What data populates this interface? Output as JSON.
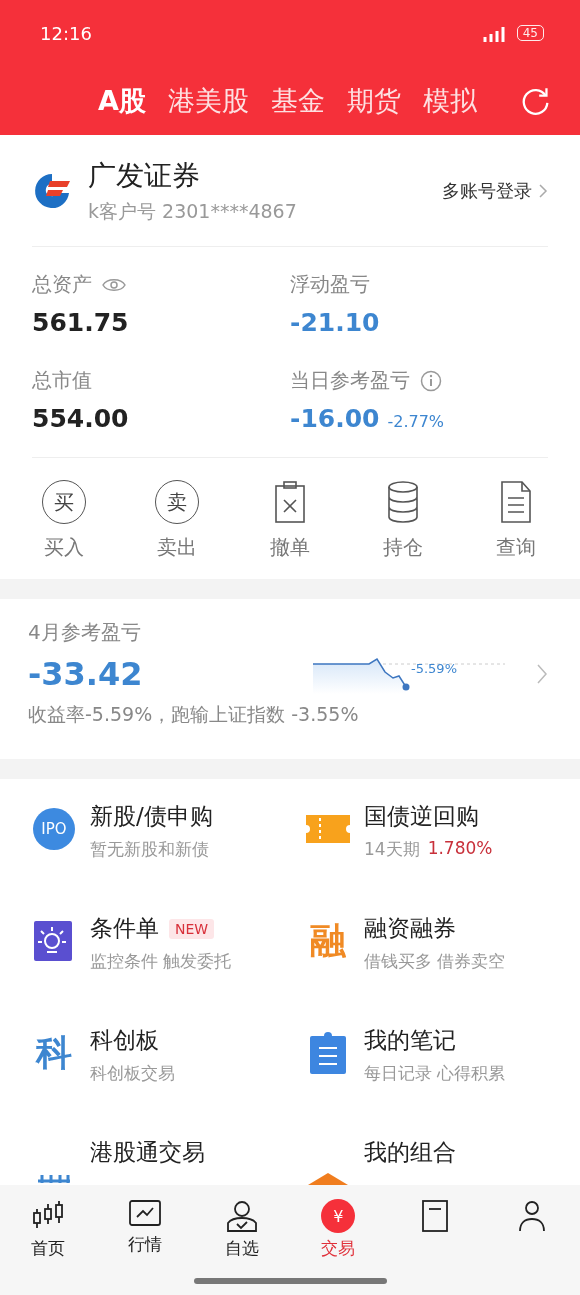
{
  "status_bar": {
    "time": "12:16",
    "battery": "45"
  },
  "market_tabs": [
    {
      "label": "A股",
      "selected": true
    },
    {
      "label": "港美股",
      "selected": false
    },
    {
      "label": "基金",
      "selected": false
    },
    {
      "label": "期货",
      "selected": false
    },
    {
      "label": "模拟",
      "selected": false
    }
  ],
  "account": {
    "broker": "广发证券",
    "account_id": "k客户号 2301****4867",
    "switch_link": "多账号登录"
  },
  "stats": [
    {
      "label": "总资产",
      "value": "561.75",
      "negative": false,
      "kind": "eye"
    },
    {
      "label": "浮动盈亏",
      "value": "-21.10",
      "negative": true,
      "kind": "plain"
    },
    {
      "label": "总市值",
      "value": "554.00",
      "negative": false,
      "kind": "plain"
    },
    {
      "label": "当日参考盈亏",
      "value": "-16.00",
      "change": "-2.77%",
      "negative": true,
      "kind": "info"
    }
  ],
  "actions": [
    {
      "label": "买入",
      "kind": "buy",
      "glyph": "买"
    },
    {
      "label": "卖出",
      "kind": "sell",
      "glyph": "卖"
    },
    {
      "label": "撤单",
      "kind": "cancel"
    },
    {
      "label": "持仓",
      "kind": "positions"
    },
    {
      "label": "查询",
      "kind": "query"
    }
  ],
  "monthly": {
    "title": "4月参考盈亏",
    "value": "-33.42",
    "summary": "收益率-5.59%，跑输上证指数 -3.55%",
    "chart_label": "-5.59%"
  },
  "services": [
    {
      "title": "新股/债申购",
      "subtitle": "暂无新股和新债",
      "kind": "ipo",
      "icon_text": "IPO"
    },
    {
      "title": "国债逆回购",
      "subtitle": "14天期",
      "rate": "1.780%",
      "kind": "ticket"
    },
    {
      "title": "条件单",
      "badge": "NEW",
      "subtitle": "监控条件 触发委托",
      "kind": "bulb"
    },
    {
      "title": "融资融券",
      "subtitle": "借钱买多 借券卖空",
      "kind": "glyph",
      "icon_text": "融"
    },
    {
      "title": "科创板",
      "subtitle": "科创板交易",
      "kind": "glyph_blue",
      "icon_text": "科"
    },
    {
      "title": "我的笔记",
      "subtitle": "每日记录 心得积累",
      "kind": "notes"
    },
    {
      "title": "港股通交易",
      "kind": "bridge"
    },
    {
      "title": "我的组合",
      "kind": "roof"
    }
  ],
  "bottom_nav": [
    {
      "label": "首页",
      "kind": "candles",
      "selected": false
    },
    {
      "label": "行情",
      "kind": "chart",
      "selected": false
    },
    {
      "label": "自选",
      "kind": "person",
      "selected": false
    },
    {
      "label": "交易",
      "kind": "trade",
      "icon_text": "¥",
      "selected": true
    },
    {
      "kind": "doc",
      "selected": false
    },
    {
      "kind": "user",
      "selected": false
    }
  ]
}
